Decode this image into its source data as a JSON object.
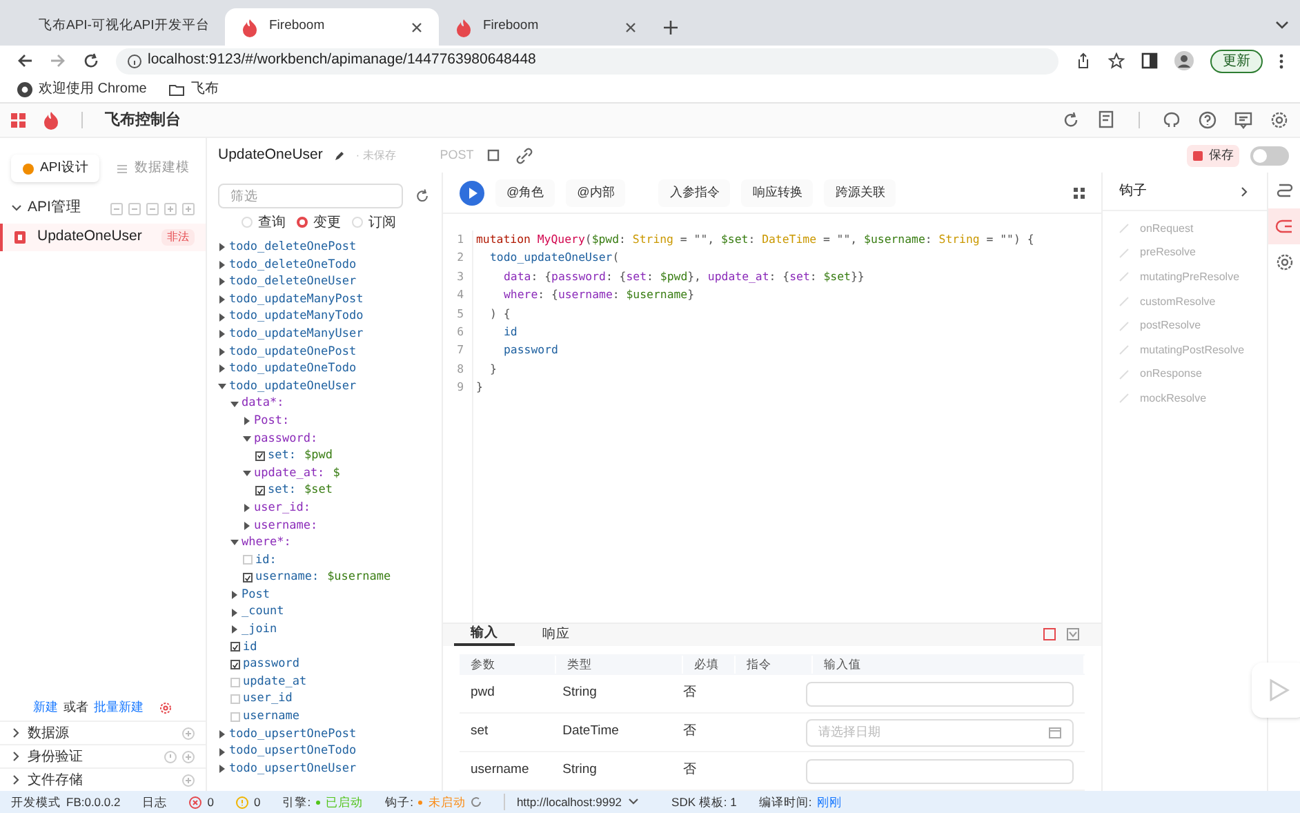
{
  "browser": {
    "tabs": [
      {
        "title": "飞布API-可视化API开发平台",
        "selected": false
      },
      {
        "title": "Fireboom",
        "selected": true
      },
      {
        "title": "Fireboom",
        "selected": false
      }
    ],
    "url": "localhost:9123/#/workbench/apimanage/1447763980648448",
    "update_button": "更新",
    "bookmarks": [
      {
        "kind": "chrome",
        "label": "欢迎使用 Chrome"
      },
      {
        "kind": "folder",
        "label": "飞布"
      }
    ]
  },
  "app": {
    "title": "飞布控制台"
  },
  "sidebar": {
    "tabs": [
      {
        "label": "API设计",
        "selected": true
      },
      {
        "label": "数据建模",
        "selected": false
      }
    ],
    "section": {
      "label": "API管理",
      "expanded": true
    },
    "items": [
      {
        "label": "UpdateOneUser",
        "badge": "非法",
        "selected": true
      }
    ],
    "create": {
      "new": "新建",
      "or": "或者",
      "batch": "批量新建"
    },
    "groups": [
      {
        "label": "数据源",
        "expanded": false
      },
      {
        "label": "身份验证",
        "expanded": false
      },
      {
        "label": "文件存储",
        "expanded": false
      }
    ]
  },
  "api_header": {
    "name": "UpdateOneUser",
    "state": "· 未保存",
    "method": "POST",
    "save": "保存",
    "enabled": false
  },
  "explorer": {
    "filter_placeholder": "筛选",
    "modes": [
      {
        "label": "查询",
        "selected": false
      },
      {
        "label": "变更",
        "selected": true
      },
      {
        "label": "订阅",
        "selected": false
      }
    ],
    "tree": [
      {
        "kind": "branch",
        "label": "todo_deleteOnePost",
        "expanded": false
      },
      {
        "kind": "branch",
        "label": "todo_deleteOneTodo",
        "expanded": false
      },
      {
        "kind": "branch",
        "label": "todo_deleteOneUser",
        "expanded": false
      },
      {
        "kind": "branch",
        "label": "todo_updateManyPost",
        "expanded": false
      },
      {
        "kind": "branch",
        "label": "todo_updateManyTodo",
        "expanded": false
      },
      {
        "kind": "branch",
        "label": "todo_updateManyUser",
        "expanded": false
      },
      {
        "kind": "branch",
        "label": "todo_updateOnePost",
        "expanded": false
      },
      {
        "kind": "branch",
        "label": "todo_updateOneTodo",
        "expanded": false
      },
      {
        "kind": "branch",
        "label": "todo_updateOneUser",
        "expanded": true,
        "children": [
          {
            "kind": "arg",
            "label": "data*:",
            "expanded": true,
            "children": [
              {
                "kind": "arg",
                "label": "Post:",
                "expanded": false
              },
              {
                "kind": "arg",
                "label": "password:",
                "expanded": true,
                "children": [
                  {
                    "kind": "check",
                    "label": "set:",
                    "value": "$pwd",
                    "checked": true
                  }
                ]
              },
              {
                "kind": "arg",
                "label": "update_at:",
                "value": "$",
                "expanded": true,
                "children": [
                  {
                    "kind": "check",
                    "label": "set:",
                    "value": "$set",
                    "checked": true
                  }
                ]
              },
              {
                "kind": "arg",
                "label": "user_id:",
                "expanded": false
              },
              {
                "kind": "arg",
                "label": "username:",
                "expanded": false
              }
            ]
          },
          {
            "kind": "arg",
            "label": "where*:",
            "expanded": true,
            "children": [
              {
                "kind": "check",
                "label": "id:",
                "checked": false
              },
              {
                "kind": "check",
                "label": "username:",
                "value": "$username",
                "checked": true
              }
            ]
          },
          {
            "kind": "branch",
            "label": "Post",
            "expanded": false
          },
          {
            "kind": "branch",
            "label": "_count",
            "expanded": false
          },
          {
            "kind": "branch",
            "label": "_join",
            "expanded": false
          },
          {
            "kind": "check",
            "label": "id",
            "checked": true
          },
          {
            "kind": "check",
            "label": "password",
            "checked": true
          },
          {
            "kind": "check",
            "label": "update_at",
            "checked": false
          },
          {
            "kind": "check",
            "label": "user_id",
            "checked": false
          },
          {
            "kind": "check",
            "label": "username",
            "checked": false
          }
        ]
      },
      {
        "kind": "branch",
        "label": "todo_upsertOnePost",
        "expanded": false
      },
      {
        "kind": "branch",
        "label": "todo_upsertOneTodo",
        "expanded": false
      },
      {
        "kind": "branch",
        "label": "todo_upsertOneUser",
        "expanded": false
      }
    ]
  },
  "editor": {
    "toolbar": [
      "@角色",
      "@内部",
      "入参指令",
      "响应转换",
      "跨源关联"
    ],
    "lines": [
      {
        "kind": "top",
        "tokens": [
          {
            "text": "mutation ",
            "kind": "kw"
          },
          {
            "text": "MyQuery",
            "kind": "def"
          },
          {
            "text": "(",
            "kind": "p"
          },
          {
            "text": "$pwd",
            "kind": "var"
          },
          {
            "text": ": ",
            "kind": "p"
          },
          {
            "text": "String",
            "kind": "type"
          },
          {
            "text": " = \"\", ",
            "kind": "p"
          },
          {
            "text": "$set",
            "kind": "var"
          },
          {
            "text": ": ",
            "kind": "p"
          },
          {
            "text": "DateTime",
            "kind": "type"
          },
          {
            "text": " = \"\", ",
            "kind": "p"
          },
          {
            "text": "$username",
            "kind": "var"
          },
          {
            "text": ": ",
            "kind": "p"
          },
          {
            "text": "String",
            "kind": "type"
          },
          {
            "text": " = \"\") {",
            "kind": "p"
          }
        ]
      },
      {
        "kind": "indent1",
        "tokens": [
          {
            "text": "todo_updateOneUser",
            "kind": "field"
          },
          {
            "text": "(",
            "kind": "p"
          }
        ]
      },
      {
        "kind": "indent2",
        "tokens": [
          {
            "text": "data",
            "kind": "arg"
          },
          {
            "text": ": {",
            "kind": "p"
          },
          {
            "text": "password",
            "kind": "arg"
          },
          {
            "text": ": {",
            "kind": "p"
          },
          {
            "text": "set",
            "kind": "arg"
          },
          {
            "text": ": ",
            "kind": "p"
          },
          {
            "text": "$pwd",
            "kind": "var"
          },
          {
            "text": "}, ",
            "kind": "p"
          },
          {
            "text": "update_at",
            "kind": "arg"
          },
          {
            "text": ": {",
            "kind": "p"
          },
          {
            "text": "set",
            "kind": "arg"
          },
          {
            "text": ": ",
            "kind": "p"
          },
          {
            "text": "$set",
            "kind": "var"
          },
          {
            "text": "}}",
            "kind": "p"
          }
        ]
      },
      {
        "kind": "indent2",
        "tokens": [
          {
            "text": "where",
            "kind": "arg"
          },
          {
            "text": ": {",
            "kind": "p"
          },
          {
            "text": "username",
            "kind": "arg"
          },
          {
            "text": ": ",
            "kind": "p"
          },
          {
            "text": "$username",
            "kind": "var"
          },
          {
            "text": "}",
            "kind": "p"
          }
        ]
      },
      {
        "kind": "indent1",
        "tokens": [
          {
            "text": ") {",
            "kind": "p"
          }
        ]
      },
      {
        "kind": "indent2",
        "tokens": [
          {
            "text": "id",
            "kind": "field"
          }
        ]
      },
      {
        "kind": "indent2",
        "tokens": [
          {
            "text": "password",
            "kind": "field"
          }
        ]
      },
      {
        "kind": "indent1",
        "tokens": [
          {
            "text": "}",
            "kind": "p"
          }
        ]
      },
      {
        "kind": "top",
        "tokens": [
          {
            "text": "}",
            "kind": "p"
          }
        ]
      }
    ],
    "line_numbers": [
      "1",
      "2",
      "3",
      "4",
      "5",
      "6",
      "7",
      "8",
      "9"
    ]
  },
  "params": {
    "tabs": [
      {
        "label": "输入",
        "selected": true
      },
      {
        "label": "响应",
        "selected": false
      }
    ],
    "columns": [
      "参数",
      "类型",
      "必填",
      "指令",
      "输入值"
    ],
    "rows": [
      {
        "name": "pwd",
        "type": "String",
        "required": "否",
        "kind": "text"
      },
      {
        "name": "set",
        "type": "DateTime",
        "required": "否",
        "kind": "date",
        "placeholder": "请选择日期"
      },
      {
        "name": "username",
        "type": "String",
        "required": "否",
        "kind": "text"
      }
    ]
  },
  "hooks": {
    "title": "钩子",
    "items": [
      "onRequest",
      "preResolve",
      "mutatingPreResolve",
      "customResolve",
      "postResolve",
      "mutatingPostResolve",
      "onResponse",
      "mockResolve"
    ]
  },
  "status_bar": {
    "mode": "开发模式",
    "version": "FB:0.0.0.2",
    "log": "日志",
    "errors": "0",
    "warnings": "0",
    "engine": {
      "label": "引擎:",
      "status": "已启动",
      "color": "#52c41a"
    },
    "hook_server": {
      "label": "钩子:",
      "status": "未启动",
      "color": "#fa8c16"
    },
    "url": "http://localhost:9992",
    "sdk": "SDK 模板: 1",
    "compile_label": "编译时间:",
    "compile_value": "刚刚"
  }
}
